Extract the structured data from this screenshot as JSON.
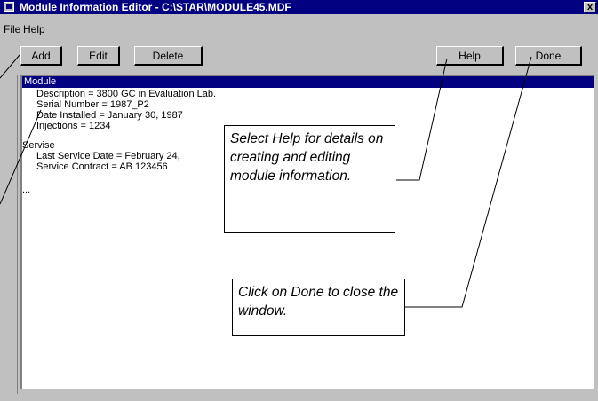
{
  "window": {
    "title": "Module Information Editor - C:\\STAR\\MODULE45.MDF",
    "close_label": "x"
  },
  "menu": {
    "file": "File",
    "help": "Help"
  },
  "buttons": {
    "add": "Add",
    "edit": "Edit",
    "delete": "Delete",
    "help": "Help",
    "done": "Done"
  },
  "content": {
    "header": "Module",
    "lines": [
      "Description = 3800 GC in Evaluation Lab.",
      "Serial Number = 1987_P2",
      "Date Installed = January 30, 1987",
      "Injections = 1234",
      "Servise",
      "Last Service Date = February 24,",
      "Service Contract = AB 123456",
      "..."
    ]
  },
  "callouts": {
    "help": "Select Help for details on creating and editing module information.",
    "done": "Click on Done to close the window."
  },
  "colors": {
    "titlebar": "#000080",
    "window_bg": "#c0c0c0",
    "selection": "#000080"
  }
}
